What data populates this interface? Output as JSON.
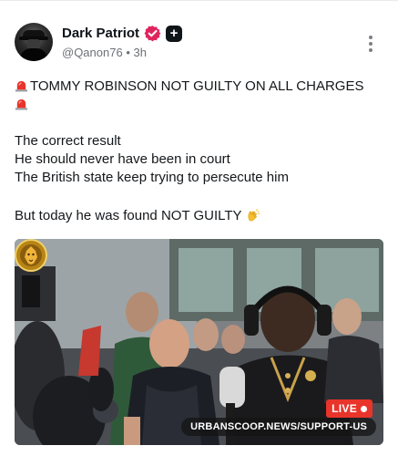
{
  "post": {
    "author": {
      "display_name": "Dark Patriot",
      "handle": "@Qanon76",
      "separator": "•",
      "time": "3h"
    },
    "badges": {
      "verified_color": "#e0245e",
      "plus_badge": "+"
    },
    "text": {
      "line1": "TOMMY ROBINSON NOT GUILTY ON ALL CHARGES",
      "line2": "The correct result",
      "line3": "He should never have been in court",
      "line4": "The British state keep trying to persecute him",
      "line5": "But today he was found NOT GUILTY"
    },
    "icons": {
      "siren": "police-car-light-icon",
      "clap": "clapping-hands-icon",
      "more": "more-options-icon"
    },
    "media": {
      "live_label": "LIVE",
      "watermark_url": "URBANSCOOP.NEWS/SUPPORT-US",
      "live_color": "#e8342b"
    }
  }
}
